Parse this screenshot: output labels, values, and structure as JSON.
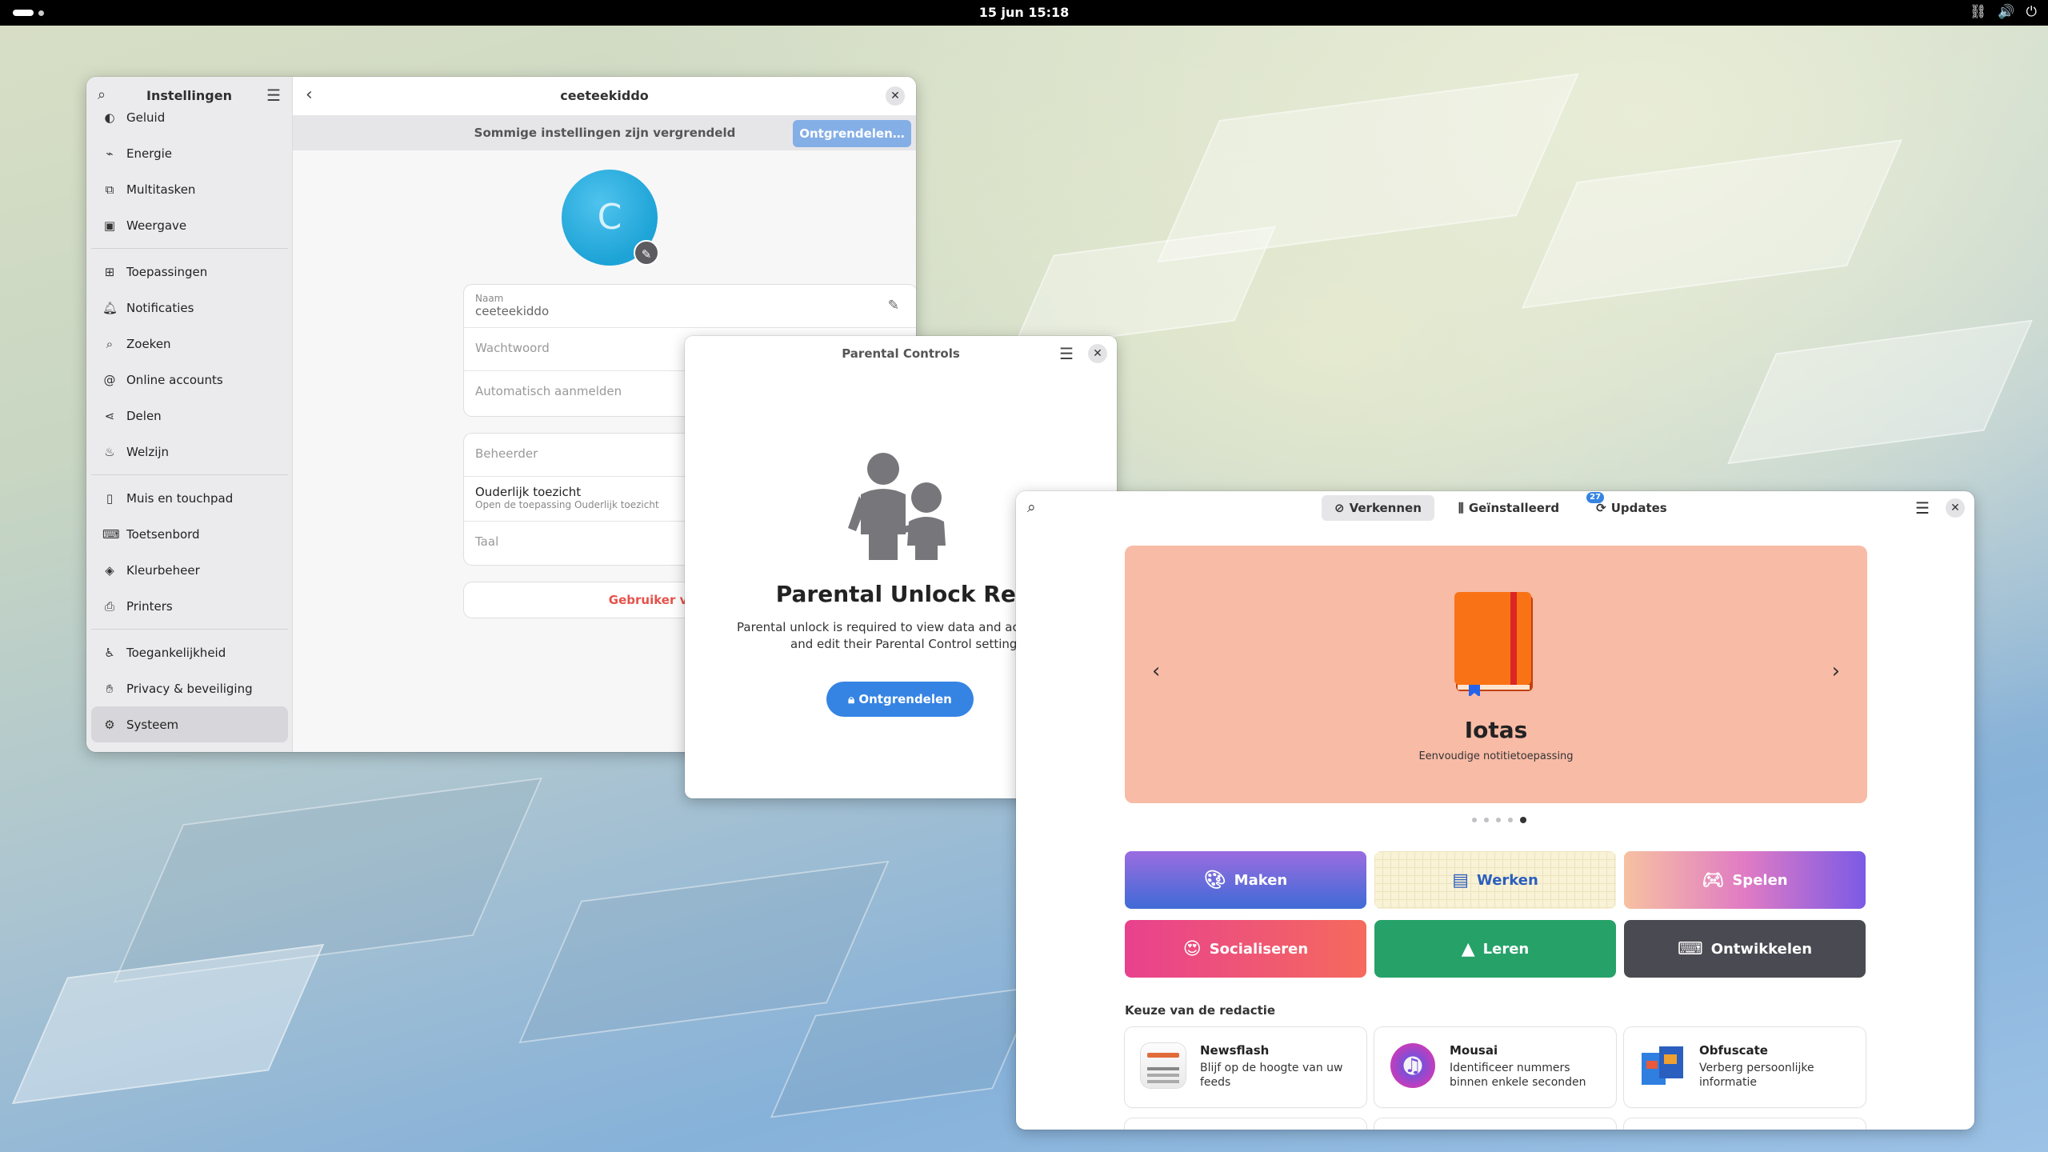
{
  "topbar": {
    "clock": "15 jun  15:18",
    "tray_icons": [
      "network-icon",
      "volume-icon",
      "power-icon"
    ]
  },
  "settings": {
    "sidebar_title": "Instellingen",
    "items": [
      {
        "label": "Geluid",
        "icon": "sound-icon"
      },
      {
        "label": "Energie",
        "icon": "power-icon"
      },
      {
        "label": "Multitasken",
        "icon": "multitasking-icon"
      },
      {
        "label": "Weergave",
        "icon": "display-icon"
      },
      {
        "label": "Toepassingen",
        "icon": "apps-icon"
      },
      {
        "label": "Notificaties",
        "icon": "bell-icon"
      },
      {
        "label": "Zoeken",
        "icon": "search-icon"
      },
      {
        "label": "Online accounts",
        "icon": "at-icon"
      },
      {
        "label": "Delen",
        "icon": "share-icon"
      },
      {
        "label": "Welzijn",
        "icon": "wellbeing-icon"
      },
      {
        "label": "Muis en touchpad",
        "icon": "mouse-icon"
      },
      {
        "label": "Toetsenbord",
        "icon": "keyboard-icon"
      },
      {
        "label": "Kleurbeheer",
        "icon": "color-icon"
      },
      {
        "label": "Printers",
        "icon": "printer-icon"
      },
      {
        "label": "Toegankelijkheid",
        "icon": "accessibility-icon"
      },
      {
        "label": "Privacy & beveiliging",
        "icon": "hand-icon"
      },
      {
        "label": "Systeem",
        "icon": "gear-icon"
      }
    ],
    "page_title": "ceeteekiddo",
    "lock_message": "Sommige instellingen zijn vergrendeld",
    "unlock_button": "Ontgrendelen…",
    "avatar_letter": "C",
    "name_caption": "Naam",
    "name_value": "ceeteekiddo",
    "password_label": "Wachtwoord",
    "autologin_label": "Automatisch aanmelden",
    "admin_label": "Beheerder",
    "parental_label": "Ouderlijk toezicht",
    "parental_sub": "Open de toepassing Ouderlijk toezicht",
    "language_label": "Taal",
    "remove_user": "Gebruiker verwijderen…"
  },
  "parental": {
    "title": "Parental Controls",
    "heading": "Parental Unlock Required",
    "description_line1": "Parental unlock is required to view data and activity for o",
    "description_line2": "and edit their Parental Control settings.",
    "unlock_button": "Ontgrendelen"
  },
  "software": {
    "tabs": [
      {
        "label": "Verkennen",
        "icon": "compass-icon",
        "active": true
      },
      {
        "label": "Geïnstalleerd",
        "icon": "library-icon",
        "active": false
      },
      {
        "label": "Updates",
        "icon": "update-icon",
        "active": false,
        "badge": "27"
      }
    ],
    "featured": {
      "name": "Iotas",
      "tagline": "Eenvoudige notitietoepassing",
      "slide": 5,
      "slides": 5
    },
    "categories": [
      {
        "label": "Maken",
        "icon": "create-icon"
      },
      {
        "label": "Werken",
        "icon": "work-icon"
      },
      {
        "label": "Spelen",
        "icon": "gamepad-icon"
      },
      {
        "label": "Socialiseren",
        "icon": "emoji-icon"
      },
      {
        "label": "Leren",
        "icon": "learn-icon"
      },
      {
        "label": "Ontwikkelen",
        "icon": "terminal-icon"
      }
    ],
    "editors_title": "Keuze van de redactie",
    "apps": [
      {
        "name": "Newsflash",
        "desc": "Blijf op de hoogte van uw feeds",
        "icon": "newsflash-icon"
      },
      {
        "name": "Mousai",
        "desc": "Identificeer nummers binnen enkele seconden",
        "icon": "mousai-icon"
      },
      {
        "name": "Obfuscate",
        "desc": "Verberg persoonlijke informatie",
        "icon": "obfuscate-icon"
      }
    ]
  }
}
